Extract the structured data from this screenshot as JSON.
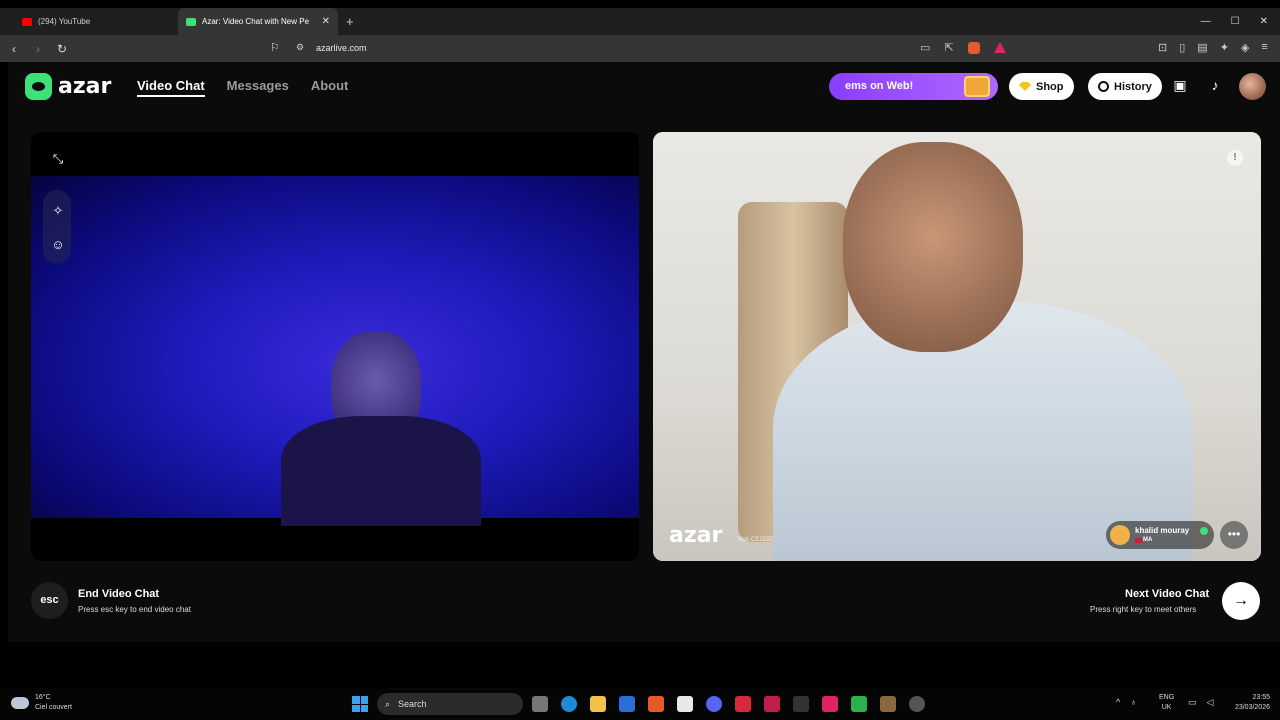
{
  "browser": {
    "tabs": [
      {
        "title": "(294) YouTube",
        "favicon_color": "#ff0000"
      },
      {
        "title": "Azar: Video Chat with New Pe",
        "favicon_color": "#3ee07a"
      }
    ],
    "url": "azarlive.com"
  },
  "app": {
    "logo": "azar",
    "nav": [
      "Video Chat",
      "Messages",
      "About"
    ],
    "promo_text": "ems on Web!",
    "shop_label": "Shop",
    "history_label": "History"
  },
  "peer": {
    "watermark": "azar",
    "vox_id": "VoX-CE2Z8Z",
    "name": "khalid mouray",
    "country": "MA"
  },
  "controls": {
    "esc_label": "esc",
    "end_title": "End Video Chat",
    "end_sub": "Press esc key to end video chat",
    "next_title": "Next Video Chat",
    "next_sub": "Press right key to meet others"
  },
  "taskbar": {
    "temperature": "16°C",
    "weather": "Ciel couvert",
    "search_placeholder": "Search",
    "lang": "ENG",
    "region": "UK",
    "time": "23:55",
    "date": "23/03/2026"
  }
}
